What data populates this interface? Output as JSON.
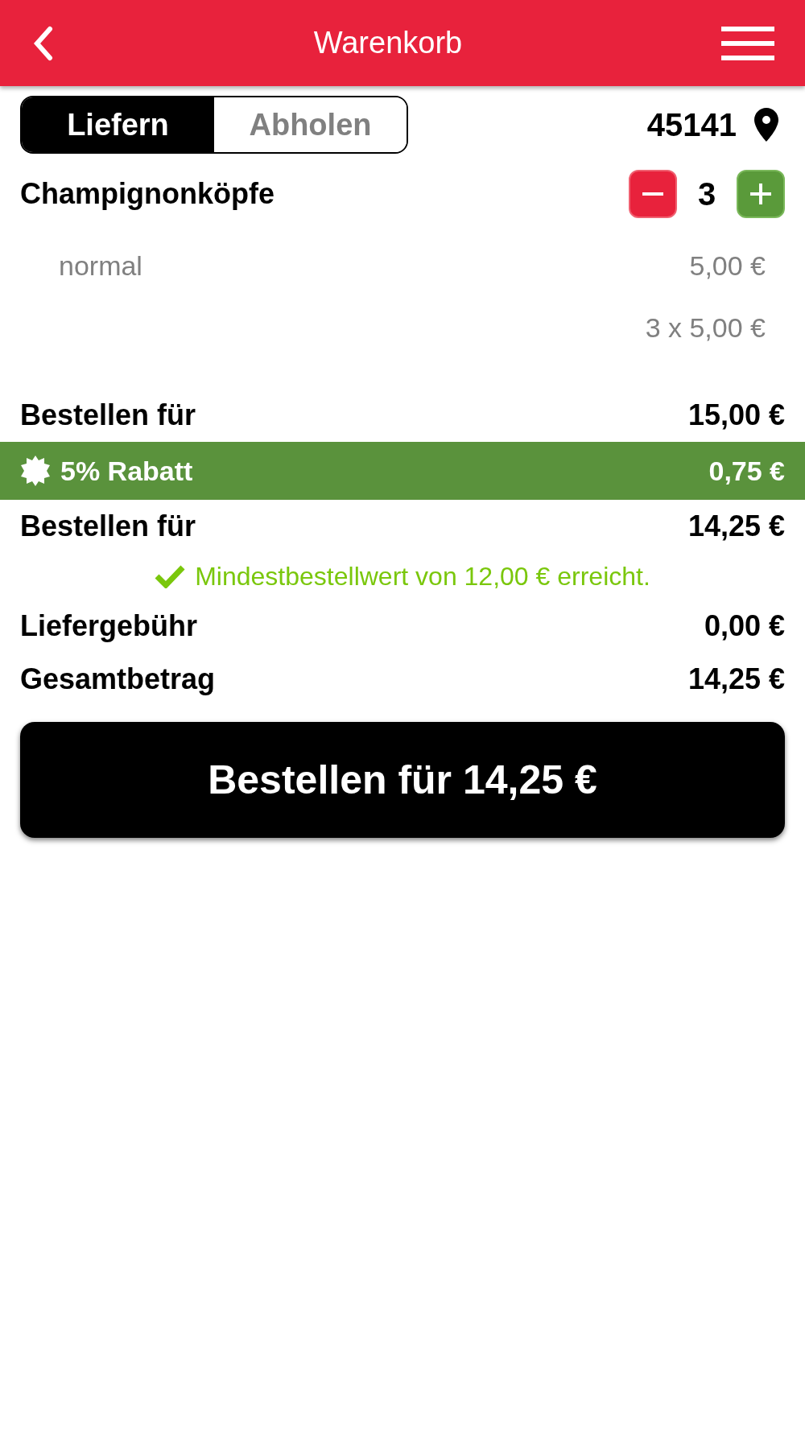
{
  "header": {
    "title": "Warenkorb"
  },
  "mode_tabs": [
    {
      "label": "Liefern",
      "selected": true
    },
    {
      "label": "Abholen",
      "selected": false
    }
  ],
  "postal_code": "45141",
  "items": [
    {
      "name": "Champignonköpfe",
      "quantity": "3",
      "option": "normal",
      "option_price": "5,00 €",
      "line_total": "3 x 5,00 €"
    }
  ],
  "summary": [
    {
      "kind": "line",
      "label": "Bestellen für",
      "value": "15,00 €"
    },
    {
      "kind": "discount",
      "label": "5% Rabatt",
      "value": "0,75 €"
    },
    {
      "kind": "line",
      "label": "Bestellen für",
      "value": "14,25 €"
    },
    {
      "kind": "notice",
      "text": "Mindestbestellwert von 12,00 € erreicht."
    },
    {
      "kind": "line",
      "label": "Liefergebühr",
      "value": "0,00 €"
    },
    {
      "kind": "line",
      "label": "Gesamtbetrag",
      "value": "14,25 €"
    }
  ],
  "order_button": "Bestellen für 14,25 €"
}
